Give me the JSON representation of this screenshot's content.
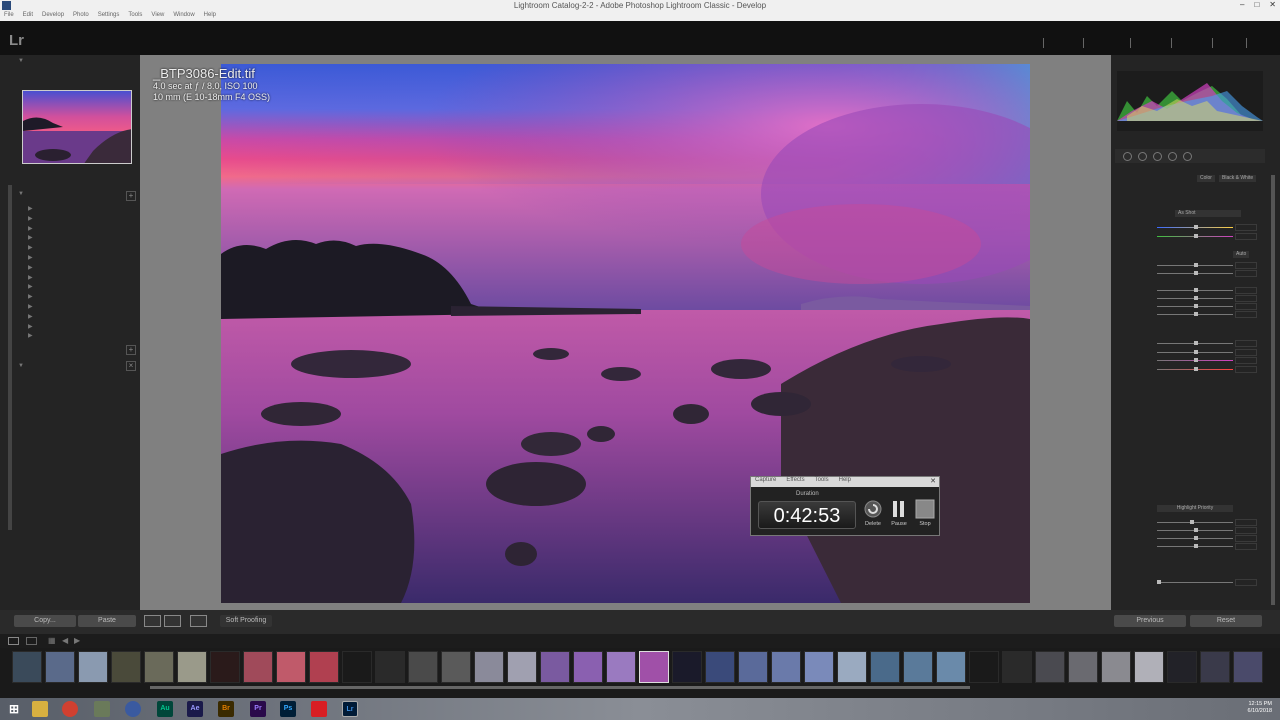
{
  "window": {
    "title": "Lightroom Catalog-2-2 - Adobe Photoshop Lightroom Classic - Develop",
    "menu": [
      "File",
      "Edit",
      "Develop",
      "Photo",
      "Settings",
      "Tools",
      "View",
      "Window",
      "Help"
    ]
  },
  "app": {
    "logo": "Lr"
  },
  "photo": {
    "filename": "_BTP3086-Edit.tif",
    "exposure": "4.0 sec at ƒ / 8.0, ISO 100",
    "lens": "10 mm (E 10-18mm F4 OSS)"
  },
  "timer_widget": {
    "menu": [
      "Capture",
      "Effects",
      "Tools",
      "Help"
    ],
    "duration_label": "Duration",
    "elapsed": "0:42:53",
    "buttons": [
      "Delete",
      "Pause",
      "Stop"
    ]
  },
  "toolbar": {
    "copy_label": "Copy...",
    "paste_label": "Paste",
    "soft_proofing_label": "Soft Proofing",
    "previous_label": "Previous",
    "reset_label": "Reset"
  },
  "right_panel": {
    "color_tab": "Color",
    "bw_tab": "Black & White",
    "wb_value": "As Shot",
    "auto_label": "Auto",
    "highlight_priority": "Highlight Priority"
  },
  "taskbar": {
    "apps": [
      "Au",
      "Ae",
      "Br",
      "Pr",
      "Ps",
      "Lr"
    ],
    "time": "12:15 PM",
    "date": "6/10/2018"
  },
  "colors": {
    "panel_bg": "#242424",
    "accent_sel": "#dddddd",
    "ps_blue": "#31a8ff",
    "lr_blue": "#3d8ee0",
    "au_green": "#00c68d",
    "ae_purple": "#9999ff",
    "br_orange": "#e37e00",
    "pr_purple": "#9c7bff",
    "acrobat_red": "#d81e23"
  }
}
